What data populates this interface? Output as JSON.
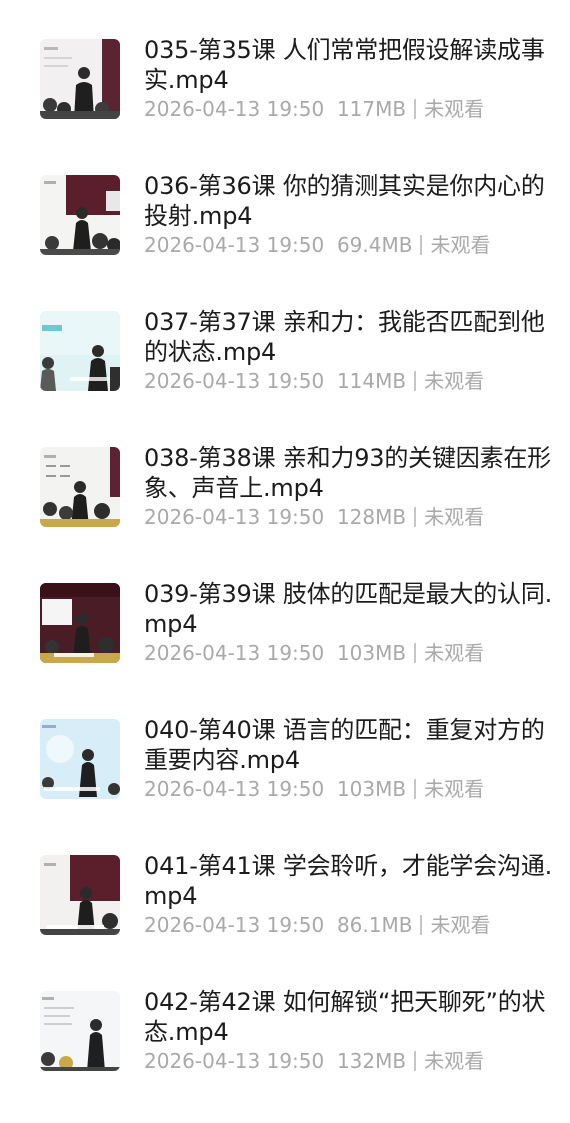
{
  "files": [
    {
      "title": "035-第35课 人们常常把假设解读成事实.mp4",
      "datetime": "2026-04-13 19:50",
      "size": "117MB",
      "status": "未观看",
      "icon": "video-thumbnail-icon"
    },
    {
      "title": "036-第36课 你的猜测其实是你内心的投射.mp4",
      "datetime": "2026-04-13 19:50",
      "size": "69.4MB",
      "status": "未观看",
      "icon": "video-thumbnail-icon"
    },
    {
      "title": "037-第37课 亲和力：我能否匹配到他的状态.mp4",
      "datetime": "2026-04-13 19:50",
      "size": "114MB",
      "status": "未观看",
      "icon": "video-thumbnail-icon"
    },
    {
      "title": "038-第38课 亲和力93的关键因素在形象、声音上.mp4",
      "datetime": "2026-04-13 19:50",
      "size": "128MB",
      "status": "未观看",
      "icon": "video-thumbnail-icon"
    },
    {
      "title": "039-第39课 肢体的匹配是最大的认同.mp4",
      "datetime": "2026-04-13 19:50",
      "size": "103MB",
      "status": "未观看",
      "icon": "video-thumbnail-icon"
    },
    {
      "title": "040-第40课 语言的匹配：重复对方的重要内容.mp4",
      "datetime": "2026-04-13 19:50",
      "size": "103MB",
      "status": "未观看",
      "icon": "video-thumbnail-icon"
    },
    {
      "title": "041-第41课 学会聆听，才能学会沟通.mp4",
      "datetime": "2026-04-13 19:50",
      "size": "86.1MB",
      "status": "未观看",
      "icon": "video-thumbnail-icon"
    },
    {
      "title": "042-第42课 如何解锁“把天聊死”的状态.mp4",
      "datetime": "2026-04-13 19:50",
      "size": "132MB",
      "status": "未观看",
      "icon": "video-thumbnail-icon"
    }
  ],
  "colors": {
    "title": "#1c1c1c",
    "meta": "#a9a9a9",
    "separator": "#c6c6c6",
    "background": "#ffffff"
  }
}
